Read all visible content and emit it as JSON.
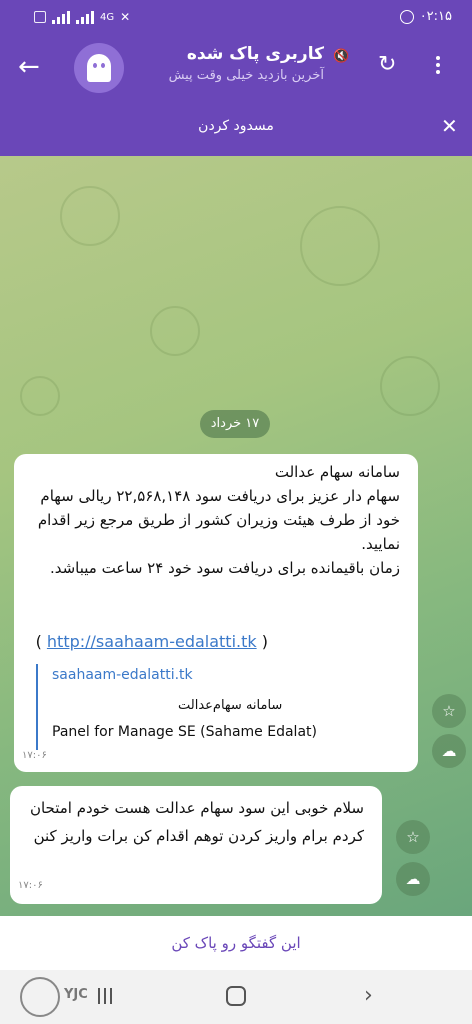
{
  "status_bar": {
    "network": "4G",
    "time": "۰۲:۱۵"
  },
  "header": {
    "title": "کاربری پاک شده",
    "subtitle": "آخرین بازدید خیلی وقت پیش",
    "back_icon": "arrow-left-icon",
    "refresh_icon": "refresh-icon",
    "menu_icon": "more-vertical-icon",
    "accent_color": "#6a47b8"
  },
  "banner": {
    "label": "مسدود کردن",
    "close_icon": "close-icon"
  },
  "chat": {
    "date": "۱۷ خرداد",
    "messages": [
      {
        "text": "سامانه سهام عدالت\nسهام دار عزیز برای دریافت سود ۲۲,۵۶۸,۱۴۸ ریالی سهام خود از طرف هیئت وزیران کشور از طریق مرجع زیر اقدام نمایید.\nزمان باقیمانده برای دریافت سود خود ۲۴ ساعت میباشد.",
        "link_open": "(",
        "link": "http://saahaam-edalatti.tk",
        "link_close": ")",
        "preview": {
          "site": "saahaam-edalatti.tk",
          "title": "سامانه سهام‌عدالت",
          "description": "Panel for Manage SE (Sahame Edalat)"
        },
        "time": "۱۷:۰۶"
      },
      {
        "text": "سلام خوبی این سود سهام عدالت هست خودم امتحان کردم برام واریز کردن توهم اقدام کن  برات واریز کنن",
        "time": "۱۷:۰۶"
      }
    ]
  },
  "footer": {
    "delete_label": "این گفتگو رو پاک کن"
  },
  "watermark": {
    "text": "YJC"
  }
}
